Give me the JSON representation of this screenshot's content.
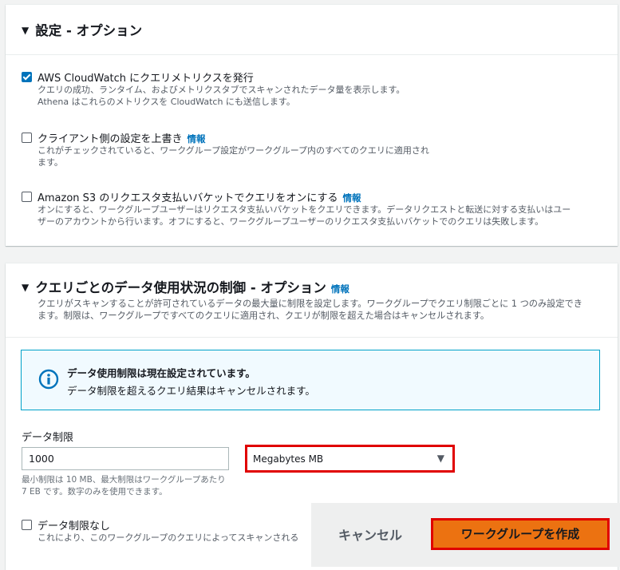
{
  "settings": {
    "title": "設定 - オプション",
    "options": [
      {
        "label": "AWS CloudWatch にクエリメトリクスを発行",
        "checked": true,
        "info": "",
        "desc": "クエリの成功、ランタイム、およびメトリクスタブでスキャンされたデータ量を表示します。",
        "desc2": "Athena はこれらのメトリクスを CloudWatch にも送信します。"
      },
      {
        "label": "クライアント側の設定を上書き",
        "checked": false,
        "info": "情報",
        "desc": "これがチェックされていると、ワークグループ設定がワークグループ内のすべてのクエリに適用され",
        "desc2": "ます。"
      },
      {
        "label": "Amazon S3 のリクエスタ支払いバケットでクエリをオンにする",
        "checked": false,
        "info": "情報",
        "desc": "オンにすると、ワークグループユーザーはリクエスタ支払いバケットをクエリできます。データリクエストと転送に対する支払いはユー",
        "desc2": "ザーのアカウントから行います。オフにすると、ワークグループユーザーのリクエスタ支払いバケットでのクエリは失敗します。"
      }
    ]
  },
  "limits": {
    "title": "クエリごとのデータ使用状況の制御 - オプション",
    "info": "情報",
    "desc": "クエリがスキャンすることが許可されているデータの最大量に制限を設定します。ワークグループでクエリ制限ごとに 1 つのみ設定でき",
    "desc2": "ます。制限は、ワークグループですべてのクエリに適用され、クエリが制限を超えた場合はキャンセルされます。",
    "alert": {
      "title": "データ使用制限は現在設定されています。",
      "text": "データ制限を超えるクエリ結果はキャンセルされます。"
    },
    "field_label": "データ制限",
    "value": "1000",
    "unit": "Megabytes MB",
    "constraint": "最小制限は 10 MB、最大制限はワークグループあたり 7 EB です。数字のみを使用できます。",
    "no_limit_label": "データ制限なし",
    "no_limit_desc": "これにより、このワークグループのクエリによってスキャンされる"
  },
  "footer": {
    "cancel": "キャンセル",
    "create": "ワークグループを作成"
  },
  "colors": {
    "accent": "#ec7211",
    "highlight": "#e00000",
    "info": "#0073bb"
  }
}
